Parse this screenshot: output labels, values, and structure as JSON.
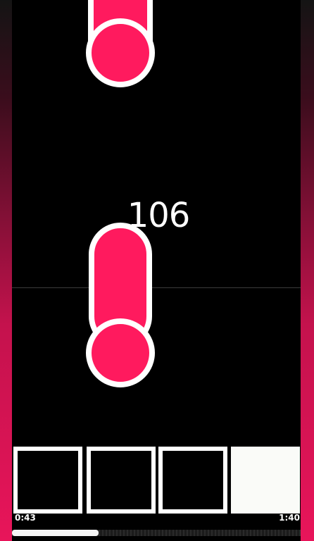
{
  "game": {
    "score": "106",
    "accent_color": "#ff1a5e",
    "outline_color": "#ffffff",
    "background_color": "#000000"
  },
  "notes": [
    {
      "type": "hold-note",
      "lane": 2,
      "state": "scrolling"
    },
    {
      "type": "hold-note",
      "lane": 2,
      "state": "active"
    }
  ],
  "tiles": [
    {
      "lane": 1,
      "state": "empty"
    },
    {
      "lane": 2,
      "state": "empty"
    },
    {
      "lane": 3,
      "state": "empty"
    },
    {
      "lane": 4,
      "state": "filled"
    }
  ],
  "playback": {
    "elapsed": "0:43",
    "total": "1:40",
    "progress_fraction": 0.3
  }
}
